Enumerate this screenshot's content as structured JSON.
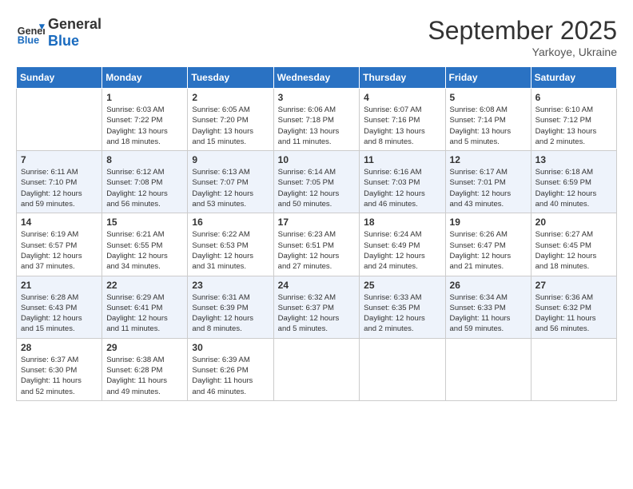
{
  "header": {
    "logo_line1": "General",
    "logo_line2": "Blue",
    "month_title": "September 2025",
    "location": "Yarkoye, Ukraine"
  },
  "weekdays": [
    "Sunday",
    "Monday",
    "Tuesday",
    "Wednesday",
    "Thursday",
    "Friday",
    "Saturday"
  ],
  "weeks": [
    [
      {
        "day": "",
        "info": ""
      },
      {
        "day": "1",
        "info": "Sunrise: 6:03 AM\nSunset: 7:22 PM\nDaylight: 13 hours\nand 18 minutes."
      },
      {
        "day": "2",
        "info": "Sunrise: 6:05 AM\nSunset: 7:20 PM\nDaylight: 13 hours\nand 15 minutes."
      },
      {
        "day": "3",
        "info": "Sunrise: 6:06 AM\nSunset: 7:18 PM\nDaylight: 13 hours\nand 11 minutes."
      },
      {
        "day": "4",
        "info": "Sunrise: 6:07 AM\nSunset: 7:16 PM\nDaylight: 13 hours\nand 8 minutes."
      },
      {
        "day": "5",
        "info": "Sunrise: 6:08 AM\nSunset: 7:14 PM\nDaylight: 13 hours\nand 5 minutes."
      },
      {
        "day": "6",
        "info": "Sunrise: 6:10 AM\nSunset: 7:12 PM\nDaylight: 13 hours\nand 2 minutes."
      }
    ],
    [
      {
        "day": "7",
        "info": "Sunrise: 6:11 AM\nSunset: 7:10 PM\nDaylight: 12 hours\nand 59 minutes."
      },
      {
        "day": "8",
        "info": "Sunrise: 6:12 AM\nSunset: 7:08 PM\nDaylight: 12 hours\nand 56 minutes."
      },
      {
        "day": "9",
        "info": "Sunrise: 6:13 AM\nSunset: 7:07 PM\nDaylight: 12 hours\nand 53 minutes."
      },
      {
        "day": "10",
        "info": "Sunrise: 6:14 AM\nSunset: 7:05 PM\nDaylight: 12 hours\nand 50 minutes."
      },
      {
        "day": "11",
        "info": "Sunrise: 6:16 AM\nSunset: 7:03 PM\nDaylight: 12 hours\nand 46 minutes."
      },
      {
        "day": "12",
        "info": "Sunrise: 6:17 AM\nSunset: 7:01 PM\nDaylight: 12 hours\nand 43 minutes."
      },
      {
        "day": "13",
        "info": "Sunrise: 6:18 AM\nSunset: 6:59 PM\nDaylight: 12 hours\nand 40 minutes."
      }
    ],
    [
      {
        "day": "14",
        "info": "Sunrise: 6:19 AM\nSunset: 6:57 PM\nDaylight: 12 hours\nand 37 minutes."
      },
      {
        "day": "15",
        "info": "Sunrise: 6:21 AM\nSunset: 6:55 PM\nDaylight: 12 hours\nand 34 minutes."
      },
      {
        "day": "16",
        "info": "Sunrise: 6:22 AM\nSunset: 6:53 PM\nDaylight: 12 hours\nand 31 minutes."
      },
      {
        "day": "17",
        "info": "Sunrise: 6:23 AM\nSunset: 6:51 PM\nDaylight: 12 hours\nand 27 minutes."
      },
      {
        "day": "18",
        "info": "Sunrise: 6:24 AM\nSunset: 6:49 PM\nDaylight: 12 hours\nand 24 minutes."
      },
      {
        "day": "19",
        "info": "Sunrise: 6:26 AM\nSunset: 6:47 PM\nDaylight: 12 hours\nand 21 minutes."
      },
      {
        "day": "20",
        "info": "Sunrise: 6:27 AM\nSunset: 6:45 PM\nDaylight: 12 hours\nand 18 minutes."
      }
    ],
    [
      {
        "day": "21",
        "info": "Sunrise: 6:28 AM\nSunset: 6:43 PM\nDaylight: 12 hours\nand 15 minutes."
      },
      {
        "day": "22",
        "info": "Sunrise: 6:29 AM\nSunset: 6:41 PM\nDaylight: 12 hours\nand 11 minutes."
      },
      {
        "day": "23",
        "info": "Sunrise: 6:31 AM\nSunset: 6:39 PM\nDaylight: 12 hours\nand 8 minutes."
      },
      {
        "day": "24",
        "info": "Sunrise: 6:32 AM\nSunset: 6:37 PM\nDaylight: 12 hours\nand 5 minutes."
      },
      {
        "day": "25",
        "info": "Sunrise: 6:33 AM\nSunset: 6:35 PM\nDaylight: 12 hours\nand 2 minutes."
      },
      {
        "day": "26",
        "info": "Sunrise: 6:34 AM\nSunset: 6:33 PM\nDaylight: 11 hours\nand 59 minutes."
      },
      {
        "day": "27",
        "info": "Sunrise: 6:36 AM\nSunset: 6:32 PM\nDaylight: 11 hours\nand 56 minutes."
      }
    ],
    [
      {
        "day": "28",
        "info": "Sunrise: 6:37 AM\nSunset: 6:30 PM\nDaylight: 11 hours\nand 52 minutes."
      },
      {
        "day": "29",
        "info": "Sunrise: 6:38 AM\nSunset: 6:28 PM\nDaylight: 11 hours\nand 49 minutes."
      },
      {
        "day": "30",
        "info": "Sunrise: 6:39 AM\nSunset: 6:26 PM\nDaylight: 11 hours\nand 46 minutes."
      },
      {
        "day": "",
        "info": ""
      },
      {
        "day": "",
        "info": ""
      },
      {
        "day": "",
        "info": ""
      },
      {
        "day": "",
        "info": ""
      }
    ]
  ]
}
